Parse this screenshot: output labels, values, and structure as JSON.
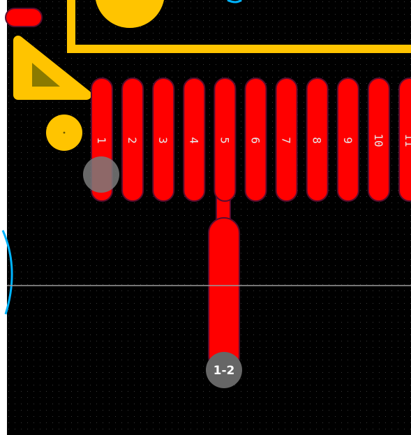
{
  "editor": {
    "board_color": "#000000",
    "grid_dot_color": "#3a3a3a",
    "crosshair_color": "#9a9a9a",
    "background": "#ffffff",
    "selection_accent": "#00b4ff"
  },
  "colors": {
    "copper_top": "#ff0000",
    "copper_outline": "#5a0d2e",
    "silkscreen": "#ffc400",
    "silkscreen_dark": "#8a7a00",
    "via_ring": "#7a7a7a"
  },
  "pads": [
    {
      "label": "1"
    },
    {
      "label": "2"
    },
    {
      "label": "3"
    },
    {
      "label": "4"
    },
    {
      "label": "5"
    },
    {
      "label": "6"
    },
    {
      "label": "7"
    },
    {
      "label": "8"
    },
    {
      "label": "9"
    },
    {
      "label": "10"
    },
    {
      "label": "11"
    }
  ],
  "via": {
    "label": "1-2"
  },
  "icons": {
    "pin1_marker": "triangle-pin1-icon",
    "origin_dot": "dot-icon"
  }
}
